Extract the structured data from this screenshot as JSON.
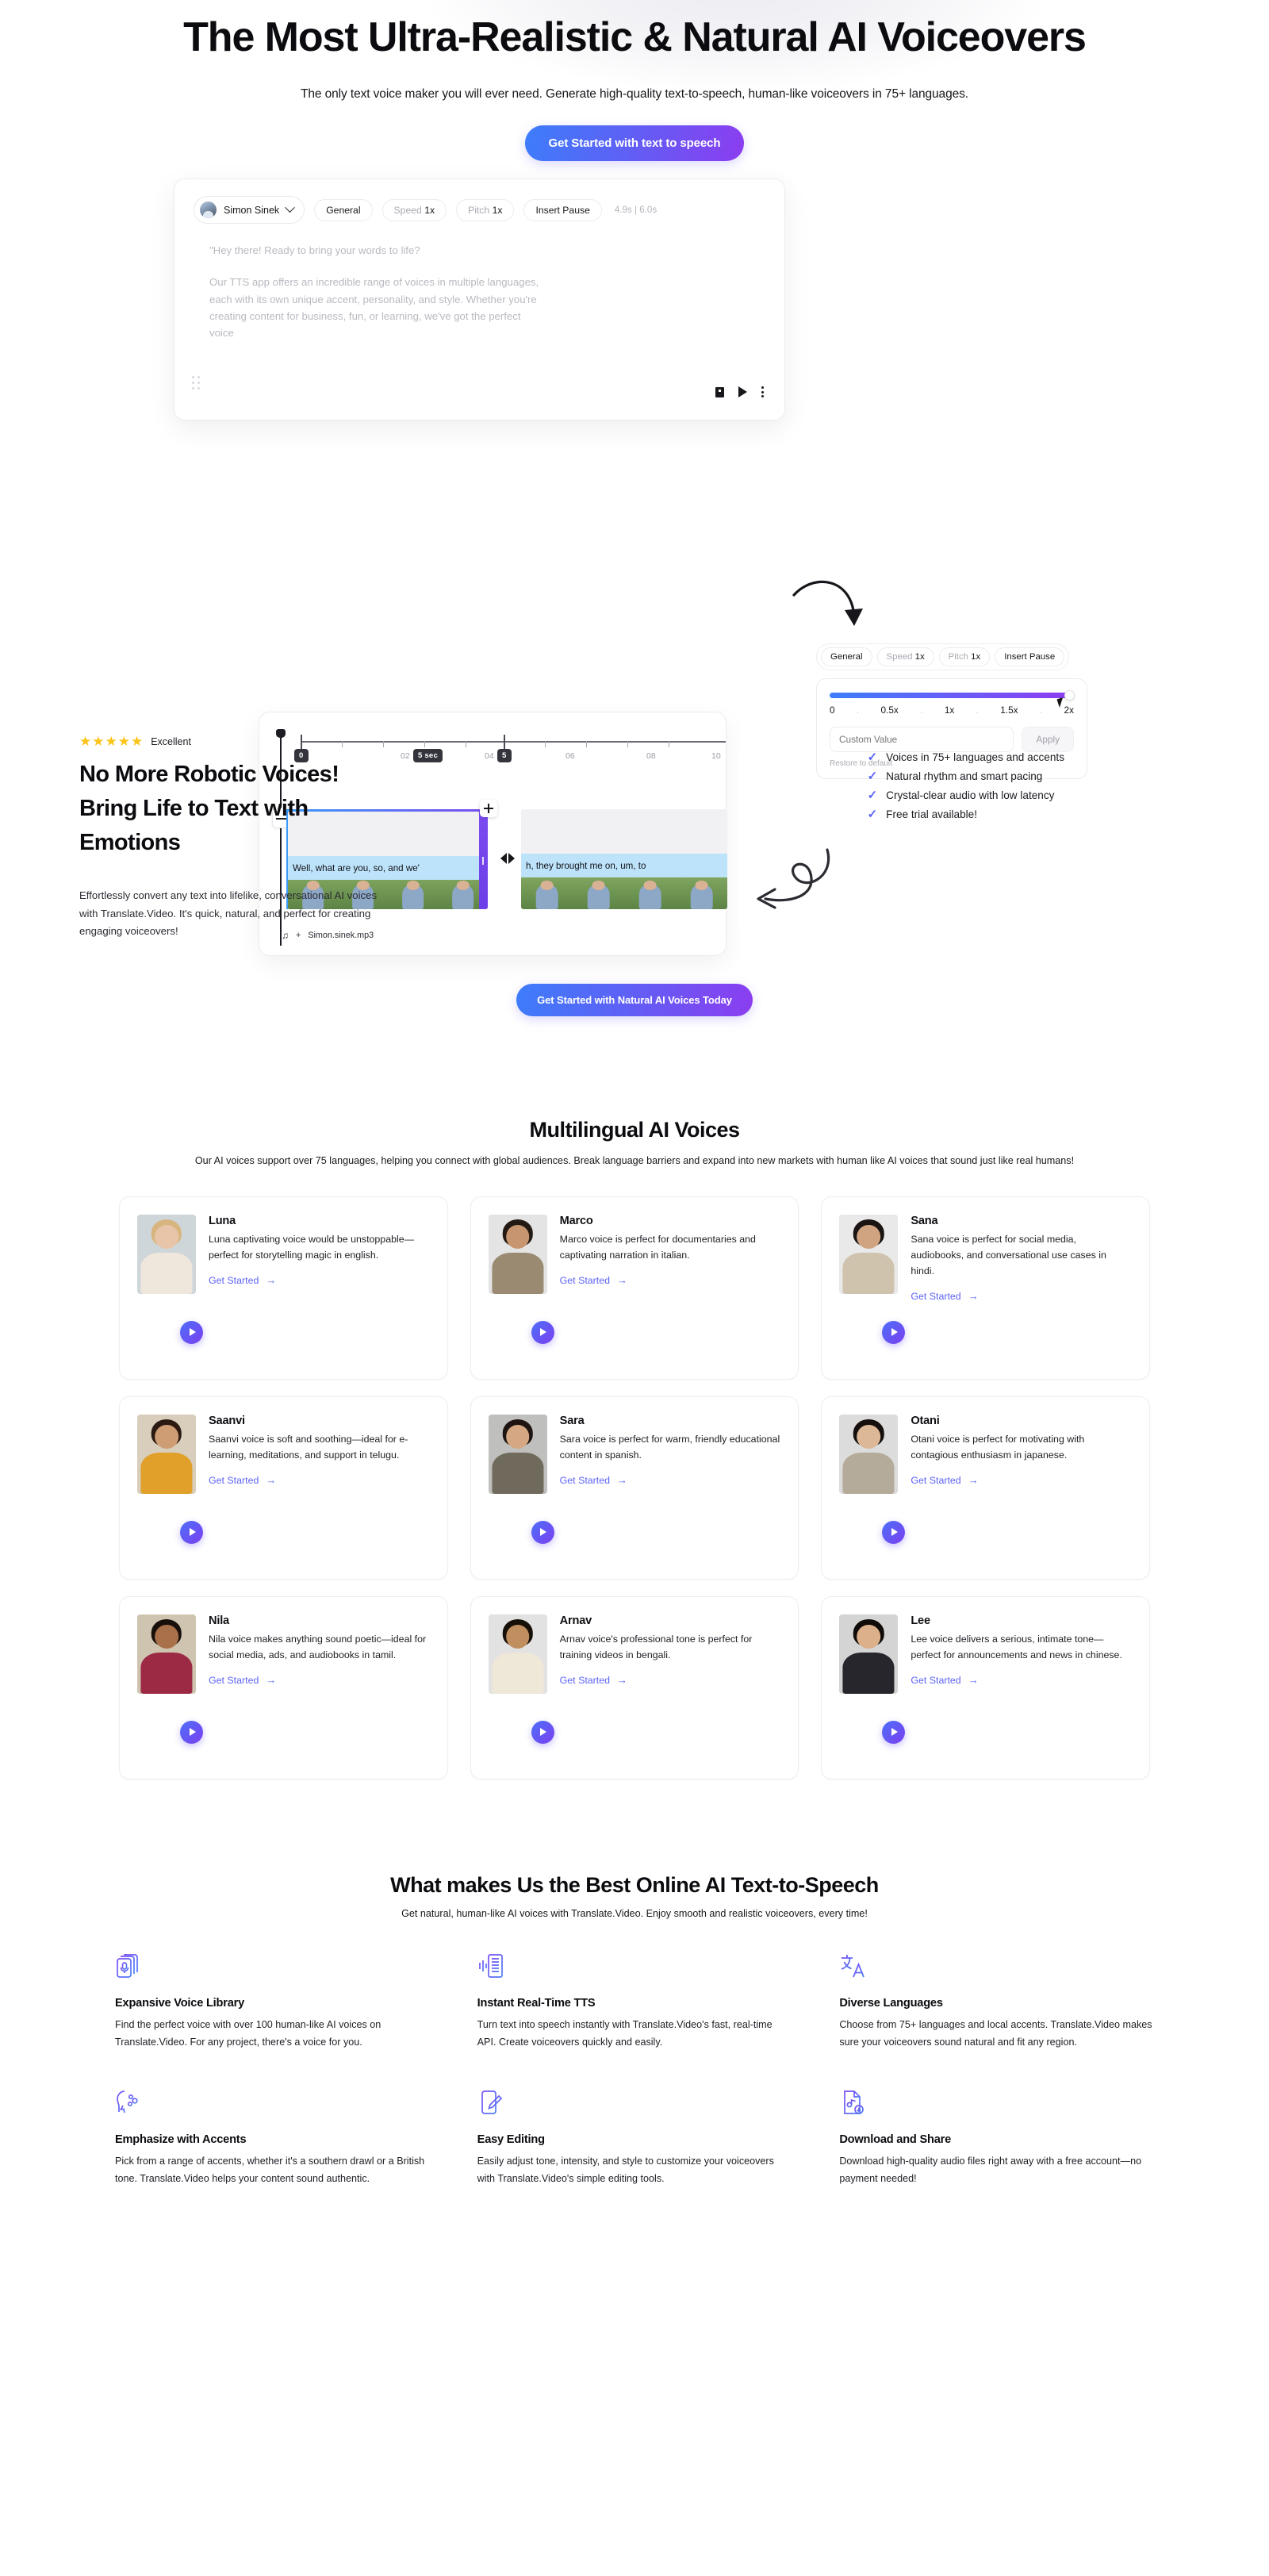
{
  "theme": {
    "accent_blue": "#3d7dfb",
    "accent_purple": "#8b3df0",
    "link": "#5b63f6",
    "star": "#fcc419"
  },
  "hero": {
    "title": "The Most Ultra-Realistic & Natural AI Voiceovers",
    "subtitle": "The only text voice maker you will ever need. Generate high-quality text-to-speech, human-like voiceovers in 75+ languages.",
    "cta": "Get Started with text to speech"
  },
  "editor": {
    "voice_name": "Simon Sinek",
    "tabs": [
      "General",
      "Speed 1x",
      "Pitch 1x",
      "Insert Pause"
    ],
    "general_label": "General",
    "speed_label": "Speed",
    "speed_value": "1x",
    "pitch_label": "Pitch",
    "pitch_value": "1x",
    "insert_pause_label": "Insert Pause",
    "duration": "4.9s  |  6.0s",
    "placeholder_line1": "\"Hey there! Ready to bring your words to life?",
    "placeholder_line2": "Our TTS app offers an incredible range of voices in multiple languages, each with its own unique accent, personality, and style. Whether you're creating content for business, fun, or learning, we've got the perfect voice"
  },
  "speed_popover": {
    "tabs": [
      "General",
      "Speed 1x",
      "Pitch 1x",
      "Insert Pause"
    ],
    "general_label": "General",
    "speed_label": "Speed",
    "speed_value": "1x",
    "pitch_label": "Pitch",
    "pitch_value": "1x",
    "insert_pause_label": "Insert Pause",
    "scale": [
      "0",
      ".",
      "0.5x",
      ".",
      "1x",
      ".",
      "1.5x",
      ".",
      "2x"
    ],
    "custom_placeholder": "Custom Value",
    "apply_label": "Apply",
    "restore_label": "Restore to default",
    "slider_percent": 100
  },
  "timeline": {
    "ruler_labels": [
      "0",
      "02",
      "04",
      "06",
      "08",
      "10"
    ],
    "marker_start": "0",
    "marker_end": "5",
    "selection_badge": "5 sec",
    "clip_a_caption": "Well, what are you, so, and we'",
    "clip_b_caption": "h, they brought me on, um, to",
    "audio_track": "Simon.sinek.mp3",
    "audio_add": "+"
  },
  "section2": {
    "rating_stars": "★★★★★",
    "rating_label": "Excellent",
    "title": "No More Robotic Voices! Bring Life to Text with Emotions",
    "body": "Effortlessly convert any text into lifelike, conversational AI voices with Translate.Video. It's quick, natural, and perfect for creating engaging voiceovers!",
    "checklist": [
      "Voices in 75+ languages and accents",
      "Natural rhythm and smart pacing",
      "Crystal-clear audio with low latency",
      "Free trial available!"
    ],
    "cta": "Get Started with Natural AI Voices Today"
  },
  "voices_section": {
    "title": "Multilingual AI Voices",
    "subtitle": "Our AI voices support over 75 languages, helping you connect with global audiences. Break language barriers and expand into new markets with human like AI voices that sound just like real humans!",
    "link_label": "Get Started",
    "link_arrow": "→",
    "cards": [
      {
        "name": "Luna",
        "desc": "Luna captivating voice would be unstoppable—perfect for storytelling magic in english.",
        "hair": "#d8b57f",
        "skin": "#e8c5a8",
        "cloth": "#efe7dc",
        "bg": "#cfd6d9"
      },
      {
        "name": "Marco",
        "desc": "Marco voice is perfect for documentaries and captivating narration in italian.",
        "hair": "#241a14",
        "skin": "#c79670",
        "cloth": "#9a8a71",
        "bg": "#e4e4e4"
      },
      {
        "name": "Sana",
        "desc": "Sana voice is perfect for social media, audiobooks, and conversational use cases in hindi.",
        "hair": "#1a1412",
        "skin": "#d0a381",
        "cloth": "#cfc3ae",
        "bg": "#e9e9e9"
      },
      {
        "name": "Saanvi",
        "desc": "Saanvi voice is soft and soothing—ideal for e-learning, meditations, and support in telugu.",
        "hair": "#2a1a12",
        "skin": "#cf9d74",
        "cloth": "#e0a02a",
        "bg": "#d9cdbb"
      },
      {
        "name": "Sara",
        "desc": "Sara voice is perfect for warm, friendly educational content in spanish.",
        "hair": "#1e1512",
        "skin": "#d5a883",
        "cloth": "#6f6a5b",
        "bg": "#bfbfbd"
      },
      {
        "name": "Otani",
        "desc": "Otani voice is perfect for motivating with contagious enthusiasm in japanese.",
        "hair": "#15100d",
        "skin": "#dcb896",
        "cloth": "#b5ab9a",
        "bg": "#dcdcdc"
      },
      {
        "name": "Nila",
        "desc": "Nila voice makes anything sound poetic—ideal for social media, ads, and audiobooks in tamil.",
        "hair": "#180f0b",
        "skin": "#a9714a",
        "cloth": "#9c2a45",
        "bg": "#cfc4b0"
      },
      {
        "name": "Arnav",
        "desc": "Arnav voice's professional tone is perfect for training videos in bengali.",
        "hair": "#171009",
        "skin": "#c08e5f",
        "cloth": "#efe7d8",
        "bg": "#e2e2e2"
      },
      {
        "name": "Lee",
        "desc": "Lee voice delivers a serious, intimate tone—perfect for announcements and news in chinese.",
        "hair": "#0f0c09",
        "skin": "#dcb08a",
        "cloth": "#26262c",
        "bg": "#d4d4d4"
      }
    ]
  },
  "features_section": {
    "title": "What makes Us the Best Online AI Text-to-Speech",
    "subtitle": "Get natural, human-like AI voices with Translate.Video. Enjoy smooth and realistic voiceovers, every time!",
    "items": [
      {
        "icon": "voice-library-icon",
        "title": "Expansive Voice Library",
        "desc": "Find the perfect voice with over 100 human-like AI voices on Translate.Video. For any project, there's a voice for you."
      },
      {
        "icon": "realtime-waveform-icon",
        "title": "Instant Real-Time TTS",
        "desc": "Turn text into speech instantly with Translate.Video's fast, real-time API. Create voiceovers quickly and easily."
      },
      {
        "icon": "translate-languages-icon",
        "title": "Diverse Languages",
        "desc": "Choose from 75+ languages and local accents. Translate.Video makes sure your voiceovers sound natural and fit any region."
      },
      {
        "icon": "accent-speech-icon",
        "title": "Emphasize with Accents",
        "desc": "Pick from a range of accents, whether it's a southern drawl or a British tone. Translate.Video helps your content sound authentic."
      },
      {
        "icon": "edit-pencil-icon",
        "title": "Easy Editing",
        "desc": "Easily adjust tone, intensity, and style to customize your voiceovers with Translate.Video's simple editing tools."
      },
      {
        "icon": "download-audio-icon",
        "title": "Download and Share",
        "desc": "Download high-quality audio files right away with a free account—no payment needed!"
      }
    ]
  }
}
